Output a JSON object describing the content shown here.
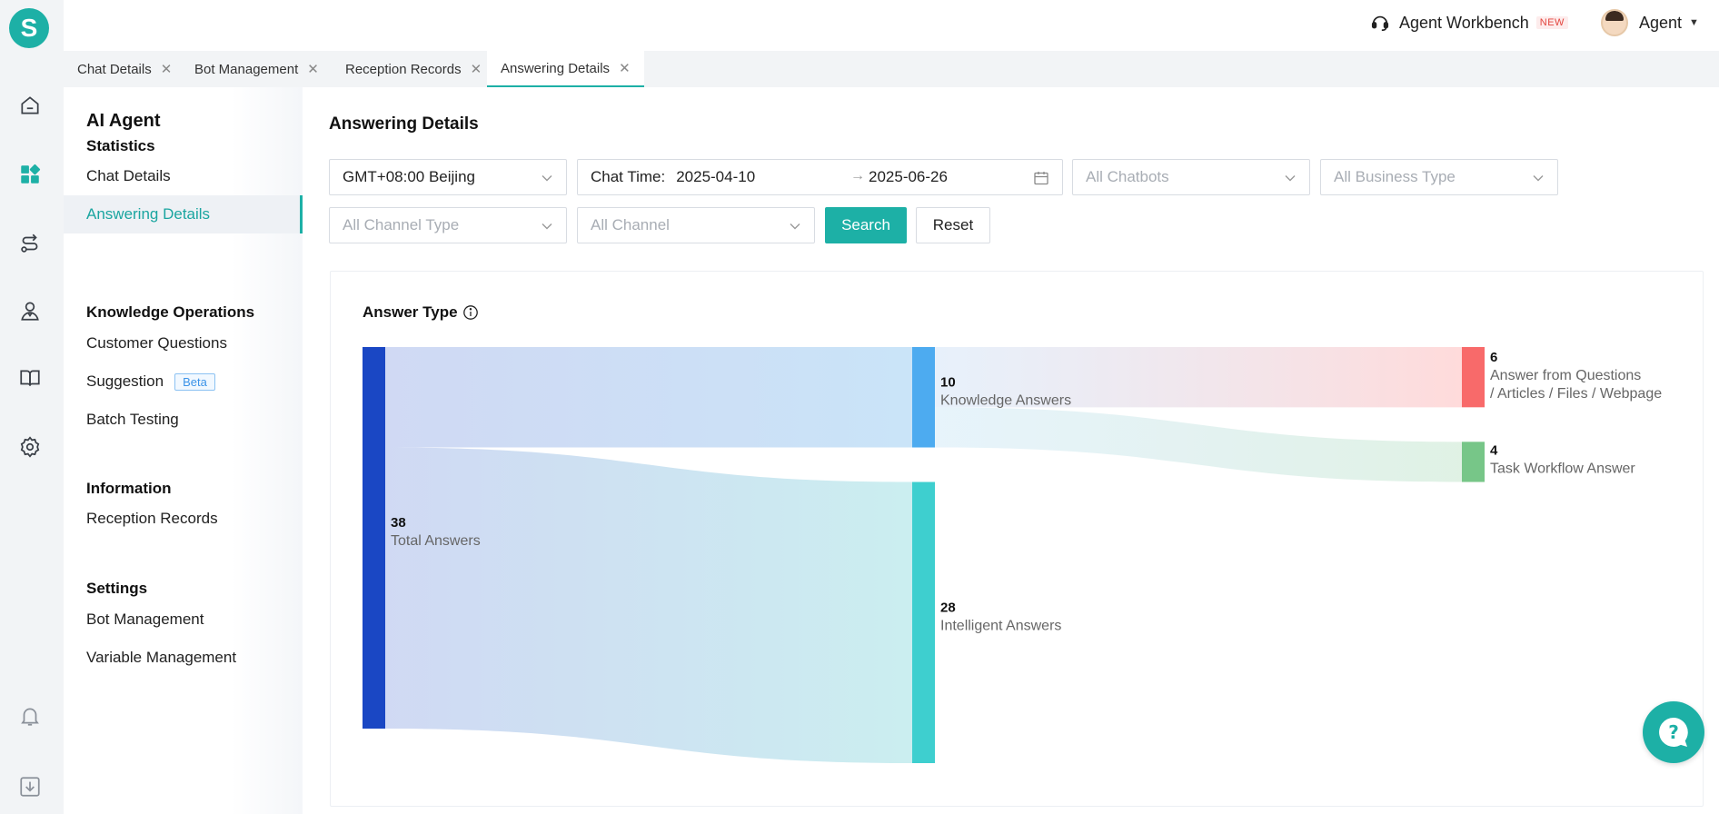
{
  "app": {
    "logo_letter": "S"
  },
  "header": {
    "workbench_label": "Agent Workbench",
    "workbench_badge": "NEW",
    "user_name": "Agent"
  },
  "rail_icons": [
    "home-icon",
    "dashboard-icon",
    "route-icon",
    "agent-icon",
    "book-icon",
    "settings-icon",
    "bell-icon",
    "download-icon"
  ],
  "tabs": [
    {
      "label": "Chat Details",
      "active": false
    },
    {
      "label": "Bot Management",
      "active": false
    },
    {
      "label": "Reception Records",
      "active": false
    },
    {
      "label": "Answering Details",
      "active": true
    }
  ],
  "sidebar": {
    "title": "AI Agent",
    "groups": [
      {
        "label": "Statistics",
        "items": [
          "Chat Details",
          "Answering Details"
        ]
      },
      {
        "label": "Knowledge Operations",
        "items": [
          "Customer Questions",
          "Suggestion",
          "Batch Testing"
        ]
      },
      {
        "label": "Information",
        "items": [
          "Reception Records"
        ]
      },
      {
        "label": "Settings",
        "items": [
          "Bot Management",
          "Variable Management"
        ]
      }
    ],
    "active_item": "Answering Details",
    "beta_badge": "Beta"
  },
  "page": {
    "title": "Answering Details"
  },
  "filters": {
    "timezone": "GMT+08:00 Beijing",
    "chat_time_label": "Chat Time:",
    "date_start": "2025-04-10",
    "date_arrow": "→",
    "date_end": "2025-06-26",
    "chatbots_placeholder": "All Chatbots",
    "business_type_placeholder": "All Business Type",
    "channel_type_placeholder": "All Channel Type",
    "channel_placeholder": "All Channel",
    "search_label": "Search",
    "reset_label": "Reset"
  },
  "chart_card": {
    "title": "Answer Type"
  },
  "chart_data": {
    "type": "sankey",
    "title": "Answer Type",
    "nodes": [
      {
        "id": "total",
        "label": "Total Answers",
        "value": 38,
        "color": "#1a47c4"
      },
      {
        "id": "knowledge",
        "label": "Knowledge Answers",
        "value": 10,
        "color": "#4dabf0"
      },
      {
        "id": "intelligent",
        "label": "Intelligent Answers",
        "value": 28,
        "color": "#3ecfcf"
      },
      {
        "id": "qafw",
        "label_lines": [
          "Answer from Questions",
          "/ Articles / Files / Webpage"
        ],
        "value": 6,
        "color": "#f86a6a"
      },
      {
        "id": "task",
        "label": "Task Workflow Answer",
        "value": 4,
        "color": "#77c688"
      }
    ],
    "links": [
      {
        "source": "total",
        "target": "knowledge",
        "value": 10
      },
      {
        "source": "total",
        "target": "intelligent",
        "value": 28
      },
      {
        "source": "knowledge",
        "target": "qafw",
        "value": 6
      },
      {
        "source": "knowledge",
        "target": "task",
        "value": 4
      }
    ]
  }
}
